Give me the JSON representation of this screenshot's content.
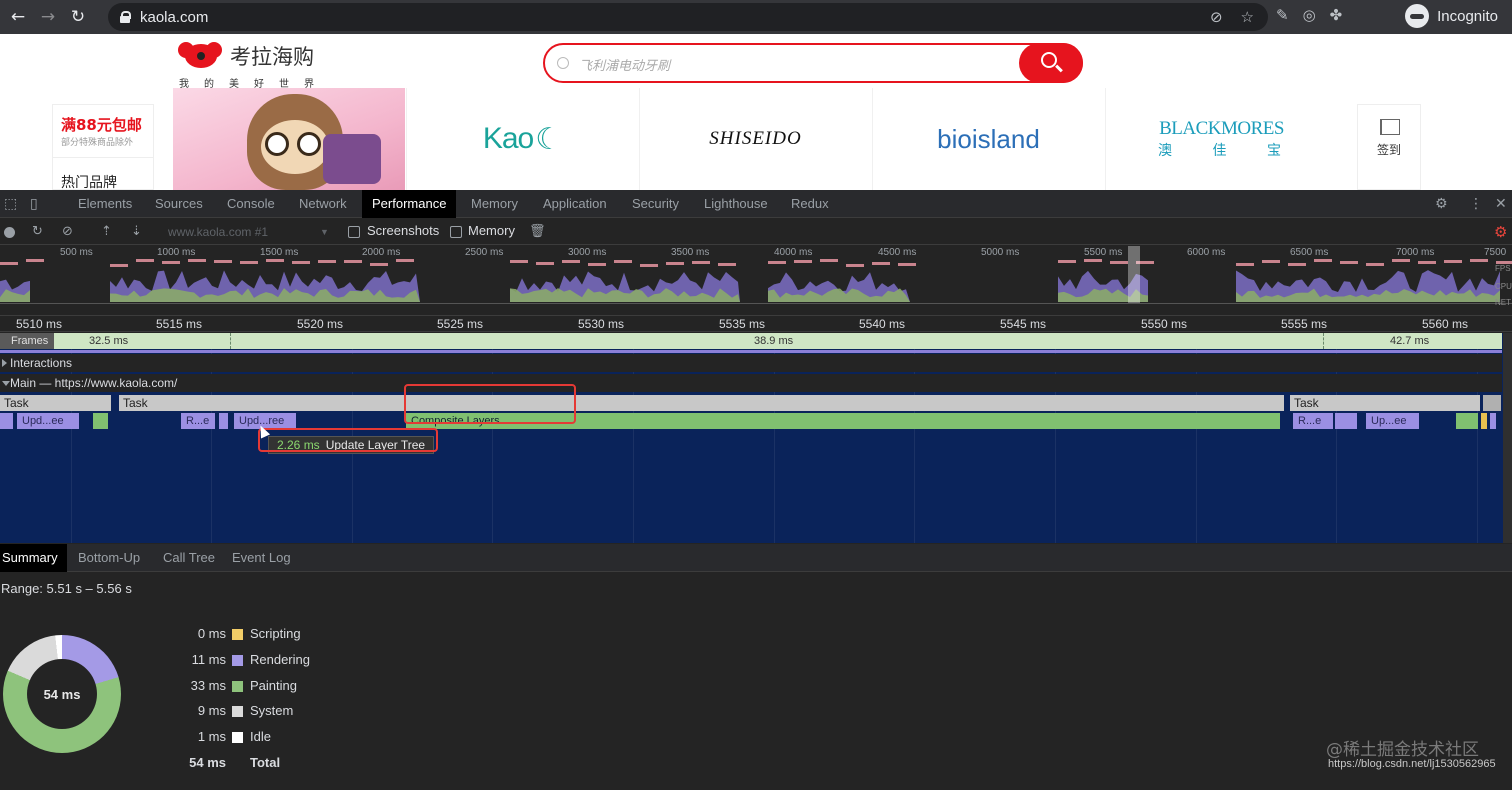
{
  "browser": {
    "url": "kaola.com",
    "profile_label": "Incognito",
    "icons": [
      "back-arrow-icon",
      "forward-arrow-icon",
      "reload-icon",
      "lock-icon",
      "eye-off-icon",
      "star-icon",
      "pen-icon",
      "target-icon",
      "puzzle-icon",
      "incognito-icon"
    ]
  },
  "site": {
    "logo_title": "考拉海购",
    "logo_subtitle": "我的美好世界",
    "search_placeholder": "飞利浦电动牙刷",
    "promo_title": "满88元包邮",
    "promo_sub": "部分特殊商品除外",
    "promo_hot": "热门品牌",
    "brands": [
      "Kao",
      "SHISEIDO",
      "bioisland",
      "BLACKMORES",
      "澳 佳 宝"
    ],
    "signin_label": "签到",
    "brand_color": "#e6141e"
  },
  "devtools": {
    "tabs": [
      "Elements",
      "Sources",
      "Console",
      "Network",
      "Performance",
      "Memory",
      "Application",
      "Security",
      "Lighthouse",
      "Redux"
    ],
    "active_tab": "Performance",
    "toolbar": {
      "profile": "www.kaola.com #1",
      "screenshots_label": "Screenshots",
      "memory_label": "Memory"
    },
    "overview_ticks": [
      "500 ms",
      "1000 ms",
      "1500 ms",
      "2000 ms",
      "2500 ms",
      "3000 ms",
      "3500 ms",
      "4000 ms",
      "4500 ms",
      "5000 ms",
      "5500 ms",
      "6000 ms",
      "6500 ms",
      "7000 ms",
      "7500"
    ],
    "overview_side": [
      "FPS",
      "CPU",
      "NET"
    ],
    "ruler_ticks": [
      "5510 ms",
      "5515 ms",
      "5520 ms",
      "5525 ms",
      "5530 ms",
      "5535 ms",
      "5540 ms",
      "5545 ms",
      "5550 ms",
      "5555 ms",
      "5560 ms"
    ],
    "frames_label": "Frames",
    "frame_times": [
      "32.5 ms",
      "38.9 ms",
      "42.7 ms"
    ],
    "interactions_label": "Interactions",
    "main_label": "Main — https://www.kaola.com/",
    "task_label": "Task",
    "blocks": {
      "upd1": "Upd...ee",
      "re1": "R...e",
      "upd2": "Upd...ree",
      "composite": "Composite Layers",
      "re2": "R...e",
      "upd3": "Up...ee"
    },
    "tooltip": {
      "time": "2.26 ms",
      "label": "Update Layer Tree"
    },
    "bottom_tabs": [
      "Summary",
      "Bottom-Up",
      "Call Tree",
      "Event Log"
    ],
    "active_bottom_tab": "Summary",
    "range": "Range: 5.51 s – 5.56 s",
    "donut_center": "54 ms",
    "summary_rows": [
      {
        "value": "0 ms",
        "name": "Scripting",
        "color": "#f2cd67"
      },
      {
        "value": "11 ms",
        "name": "Rendering",
        "color": "#a49ae6"
      },
      {
        "value": "33 ms",
        "name": "Painting",
        "color": "#8ec37c"
      },
      {
        "value": "9 ms",
        "name": "System",
        "color": "#dadada"
      },
      {
        "value": "1 ms",
        "name": "Idle",
        "color": "#ffffff"
      }
    ],
    "summary_total": {
      "value": "54 ms",
      "name": "Total"
    },
    "watermark": "@稀土掘金技术社区",
    "watermark_url": "https://blog.csdn.net/lj1530562965"
  }
}
